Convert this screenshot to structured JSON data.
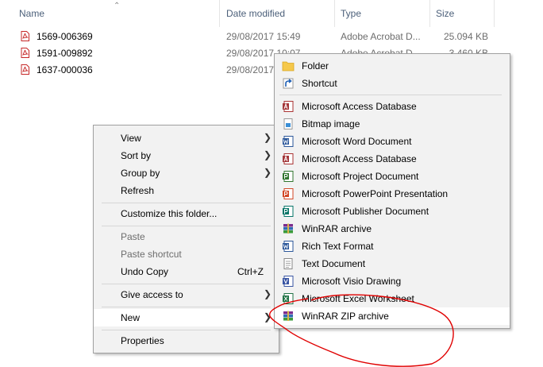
{
  "columns": {
    "name": "Name",
    "date": "Date modified",
    "type": "Type",
    "size": "Size"
  },
  "files": [
    {
      "name": "1569-006369",
      "date": "29/08/2017 15:49",
      "type": "Adobe Acrobat D...",
      "size": "25.094 KB"
    },
    {
      "name": "1591-009892",
      "date": "29/08/2017 10:07",
      "type": "Adobe Acrobat D...",
      "size": "3.460 KB"
    },
    {
      "name": "1637-000036",
      "date": "29/08/2017 ...",
      "type": "",
      "size": ""
    }
  ],
  "context_menu": {
    "view": "View",
    "sort_by": "Sort by",
    "group_by": "Group by",
    "refresh": "Refresh",
    "customize": "Customize this folder...",
    "paste": "Paste",
    "paste_shortcut": "Paste shortcut",
    "undo_copy": "Undo Copy",
    "undo_shortcut": "Ctrl+Z",
    "give_access": "Give access to",
    "new": "New",
    "properties": "Properties"
  },
  "new_submenu": {
    "folder": "Folder",
    "shortcut": "Shortcut",
    "items": [
      {
        "label": "Microsoft Access Database",
        "icon": "access-icon"
      },
      {
        "label": "Bitmap image",
        "icon": "bitmap-icon"
      },
      {
        "label": "Microsoft Word Document",
        "icon": "word-icon"
      },
      {
        "label": "Microsoft Access Database",
        "icon": "access-icon"
      },
      {
        "label": "Microsoft Project Document",
        "icon": "project-icon"
      },
      {
        "label": "Microsoft PowerPoint Presentation",
        "icon": "powerpoint-icon"
      },
      {
        "label": "Microsoft Publisher Document",
        "icon": "publisher-icon"
      },
      {
        "label": "WinRAR archive",
        "icon": "winrar-icon"
      },
      {
        "label": "Rich Text Format",
        "icon": "rtf-icon"
      },
      {
        "label": "Text Document",
        "icon": "text-icon"
      },
      {
        "label": "Microsoft Visio Drawing",
        "icon": "visio-icon"
      },
      {
        "label": "Microsoft Excel Worksheet",
        "icon": "excel-icon"
      },
      {
        "label": "WinRAR ZIP archive",
        "icon": "winrar-zip-icon"
      }
    ]
  },
  "colors": {
    "highlight": "#ffffff",
    "menu_bg": "#f2f2f2",
    "annotation": "#e00000"
  }
}
